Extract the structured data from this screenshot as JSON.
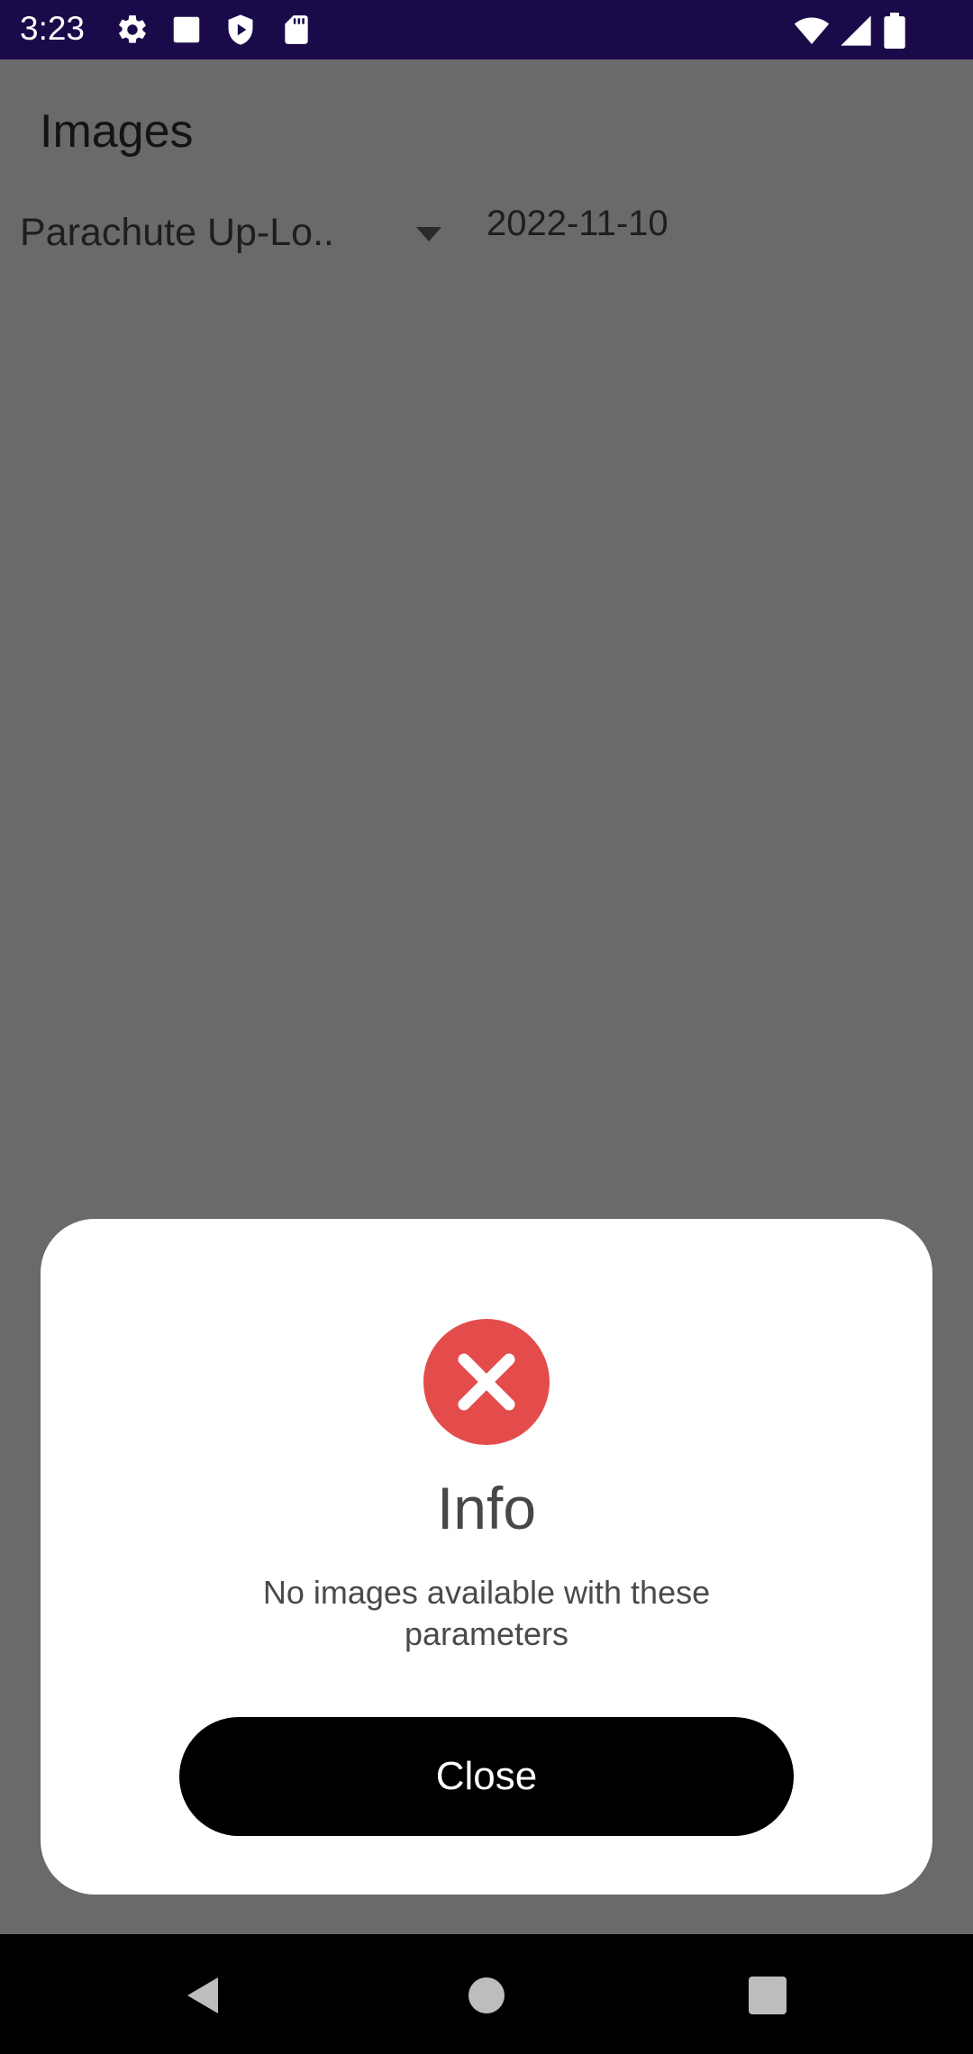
{
  "status_bar": {
    "time": "3:23",
    "left_icons": [
      "gear-icon",
      "square-icon",
      "shield-play-icon",
      "sd-card-icon"
    ],
    "right_icons": [
      "wifi-icon",
      "signal-icon",
      "battery-icon"
    ]
  },
  "screen": {
    "title": "Images",
    "dropdown_value": "Parachute Up-Lo..",
    "date_value": "2022-11-10"
  },
  "dialog": {
    "icon": "error-x-icon",
    "title": "Info",
    "message": "No images available with these parameters",
    "close_label": "Close"
  },
  "nav_bar": {
    "buttons": [
      "back-icon",
      "home-icon",
      "recents-icon"
    ]
  },
  "colors": {
    "status_bar_bg": "#1a0a4a",
    "scrim": "#6a6a6a",
    "error_red": "#e44c4c",
    "button_bg": "#000000"
  }
}
